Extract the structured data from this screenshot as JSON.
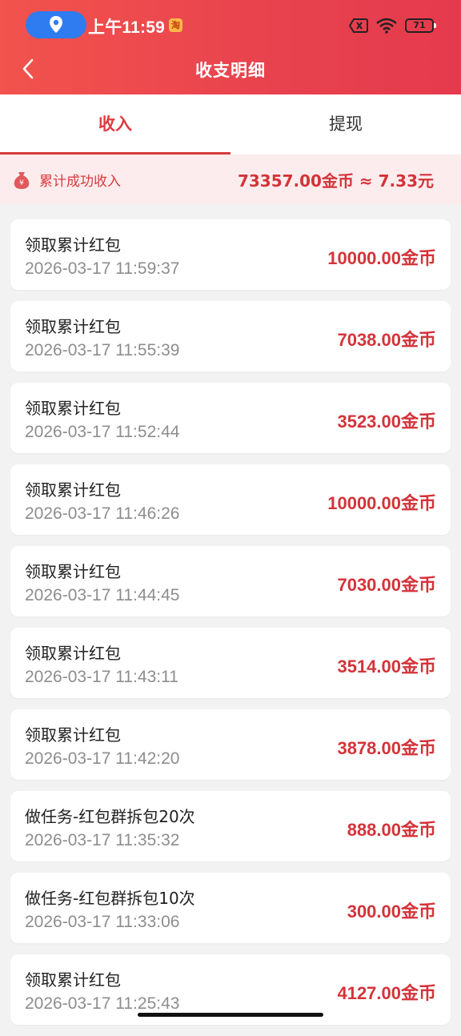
{
  "status_bar": {
    "time": "上午11:59",
    "app_badge": "淘",
    "battery": "71",
    "icons": [
      "location-pin-icon",
      "close-box-icon",
      "wifi-icon",
      "battery-icon"
    ]
  },
  "header": {
    "title": "收支明细",
    "back_icon": "chevron-left-icon"
  },
  "tabs": [
    {
      "label": "收入",
      "active": true
    },
    {
      "label": "提现",
      "active": false
    }
  ],
  "summary": {
    "label": "累计成功收入",
    "value": "73357.00金币 ≈ 7.33元",
    "icon": "money-bag-icon"
  },
  "records": [
    {
      "title": "领取累计红包",
      "time": "2026-03-17 11:59:37",
      "amount": "10000.00金币"
    },
    {
      "title": "领取累计红包",
      "time": "2026-03-17 11:55:39",
      "amount": "7038.00金币"
    },
    {
      "title": "领取累计红包",
      "time": "2026-03-17 11:52:44",
      "amount": "3523.00金币"
    },
    {
      "title": "领取累计红包",
      "time": "2026-03-17 11:46:26",
      "amount": "10000.00金币"
    },
    {
      "title": "领取累计红包",
      "time": "2026-03-17 11:44:45",
      "amount": "7030.00金币"
    },
    {
      "title": "领取累计红包",
      "time": "2026-03-17 11:43:11",
      "amount": "3514.00金币"
    },
    {
      "title": "领取累计红包",
      "time": "2026-03-17 11:42:20",
      "amount": "3878.00金币"
    },
    {
      "title": "做任务-红包群拆包20次",
      "time": "2026-03-17 11:35:32",
      "amount": "888.00金币"
    },
    {
      "title": "做任务-红包群拆包10次",
      "time": "2026-03-17 11:33:06",
      "amount": "300.00金币"
    },
    {
      "title": "领取累计红包",
      "time": "2026-03-17 11:25:43",
      "amount": "4127.00金币"
    }
  ],
  "colors": {
    "header_gradient_start": "#f2534d",
    "header_gradient_end": "#e53a4d",
    "accent_red": "#d4333a",
    "summary_bg": "#fdeced",
    "page_bg": "#f2f2f2"
  }
}
